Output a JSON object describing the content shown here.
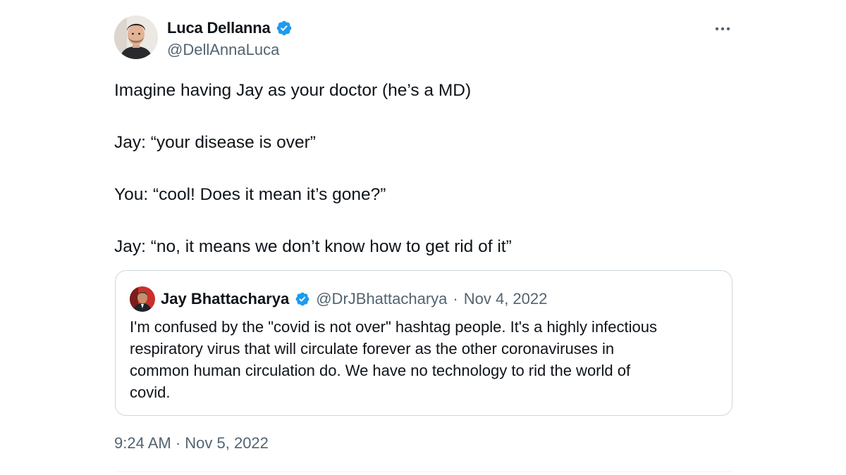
{
  "author": {
    "name": "Luca Dellanna",
    "handle": "@DellAnnaLuca",
    "verified": true,
    "avatar_icon": "portrait-man-avatar"
  },
  "more_icon": "more-horizontal-icon",
  "tweet": {
    "lines": [
      "Imagine having Jay as your doctor (he’s a MD)",
      "Jay: “your disease is over”",
      "You: “cool! Does it mean it’s gone?”",
      "Jay: “no, it means we don’t know how to get rid of it”"
    ],
    "timestamp": "9:24 AM · Nov 5, 2022"
  },
  "quoted": {
    "name": "Jay Bhattacharya",
    "handle": "@DrJBhattacharya",
    "separator": "·",
    "date": "Nov 4, 2022",
    "verified": true,
    "avatar_icon": "portrait-man-suit-avatar",
    "lines": [
      "I'm confused by the \"covid is not over\" hashtag people. It's a highly infectious",
      "respiratory virus that will circulate forever as the other coronaviruses in",
      "common human circulation do. We have no technology to rid the world of",
      "covid."
    ]
  },
  "colors": {
    "verified_blue": "#1d9bf0",
    "text_primary": "#0f1419",
    "text_secondary": "#536471",
    "border": "#cfd9de"
  }
}
